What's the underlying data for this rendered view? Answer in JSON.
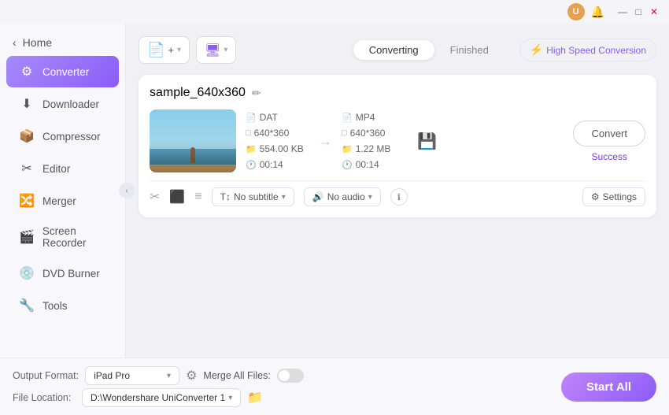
{
  "titleBar": {
    "userInitial": "U",
    "bellLabel": "🔔",
    "minimizeLabel": "—",
    "maximizeLabel": "□",
    "closeLabel": "✕"
  },
  "sidebar": {
    "homeLabel": "Home",
    "items": [
      {
        "id": "converter",
        "label": "Converter",
        "icon": "⚙",
        "active": true
      },
      {
        "id": "downloader",
        "label": "Downloader",
        "icon": "⬇",
        "active": false
      },
      {
        "id": "compressor",
        "label": "Compressor",
        "icon": "📦",
        "active": false
      },
      {
        "id": "editor",
        "label": "Editor",
        "icon": "✂",
        "active": false
      },
      {
        "id": "merger",
        "label": "Merger",
        "icon": "🔀",
        "active": false
      },
      {
        "id": "screen-recorder",
        "label": "Screen Recorder",
        "icon": "🎬",
        "active": false
      },
      {
        "id": "dvd-burner",
        "label": "DVD Burner",
        "icon": "💿",
        "active": false
      },
      {
        "id": "tools",
        "label": "Tools",
        "icon": "🔧",
        "active": false
      }
    ]
  },
  "toolbar": {
    "addFileLabel": "+",
    "addDropdownLabel": "▾",
    "addScreenLabel": "🖥",
    "tabConverting": "Converting",
    "tabFinished": "Finished",
    "speedLabel": "High Speed Conversion"
  },
  "fileCard": {
    "fileName": "sample_640x360",
    "source": {
      "format": "DAT",
      "resolution": "640*360",
      "size": "554.00 KB",
      "duration": "00:14"
    },
    "output": {
      "format": "MP4",
      "resolution": "640*360",
      "size": "1.22 MB",
      "duration": "00:14"
    },
    "convertBtnLabel": "Convert",
    "statusLabel": "Success",
    "subtitleLabel": "No subtitle",
    "audioLabel": "No audio",
    "settingsLabel": "Settings"
  },
  "bottomBar": {
    "outputFormatLabel": "Output Format:",
    "outputFormatValue": "iPad Pro",
    "fileLocationLabel": "File Location:",
    "fileLocationValue": "D:\\Wondershare UniConverter 1",
    "mergeLabel": "Merge All Files:",
    "startBtnLabel": "Start All"
  }
}
